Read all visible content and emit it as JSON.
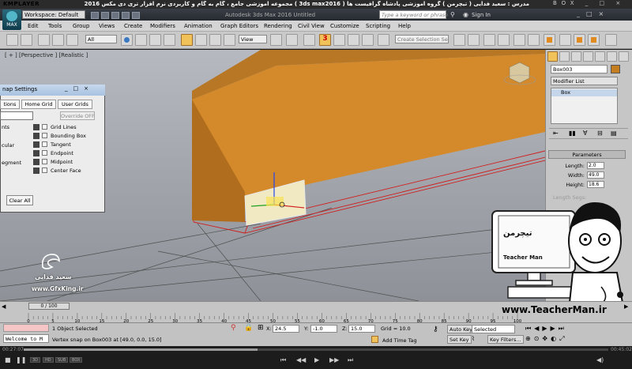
{
  "player": {
    "logo": "KMPLAYER",
    "caption": "مجموعه آموزشی جامع ، گام به گام و کاربردی نرم افزار تری دی مکس 2016 ( 3ds max2016 )  مدرس : سعید فدایی ( تیچرمن ) گروه آموزشی پادشاه گرافیست ها",
    "controls": "BOX _ □ ×",
    "elapsed": "00:27:07",
    "total": "00:45:02",
    "progress": 0.4,
    "qualities": [
      "3D",
      "HD",
      "SUB",
      "BOX"
    ]
  },
  "max": {
    "logo_text": "MAX",
    "workspace": "Workspace: Default",
    "title": "Autodesk 3ds Max 2016    Untitled",
    "search_placeholder": "Type a keyword or phrase",
    "signin": "Sign In",
    "menu": [
      "Edit",
      "Tools",
      "Group",
      "Views",
      "Create",
      "Modifiers",
      "Animation",
      "Graph Editors",
      "Rendering",
      "Civil View",
      "Customize",
      "Scripting",
      "Help"
    ],
    "toolbar": {
      "filter": "All",
      "ref_coord": "View",
      "snap_value": "3",
      "selection_set": "Create Selection Se"
    },
    "viewport_label": "[ + ] [Perspective ] [Realistic ]"
  },
  "snap_dialog": {
    "title": "nap Settings",
    "tabs": [
      "tions",
      "Home Grid",
      "User Grids"
    ],
    "override": "Override OFF",
    "row_labels": [
      "nts",
      "",
      "cular",
      "",
      "egment",
      ""
    ],
    "options": [
      "Grid Lines",
      "Bounding Box",
      "Tangent",
      "Endpoint",
      "Midpoint",
      "Center Face"
    ],
    "clear_all": "Clear All"
  },
  "command_panel": {
    "object_name": "Box003",
    "modifier_list": "Modifier List",
    "stack_item": "Box",
    "parameters_title": "Parameters",
    "params": [
      {
        "label": "Length:",
        "value": "2.0"
      },
      {
        "label": "Width:",
        "value": "49.0"
      },
      {
        "label": "Height:",
        "value": "18.6"
      }
    ],
    "faded_label": "Length Segs:"
  },
  "timeline": {
    "slider": "0 / 100",
    "ticks": [
      "0",
      "5",
      "10",
      "15",
      "20",
      "25",
      "30",
      "35",
      "40",
      "45",
      "50",
      "55",
      "60",
      "65",
      "70",
      "75",
      "80",
      "85",
      "90",
      "95",
      "100"
    ]
  },
  "status": {
    "welcome": "Welcome to M",
    "selection": "1 Object Selected",
    "snap_msg": "Vertex snap on Box003 at [49.0, 0.0, 15.0]",
    "x": "24.5",
    "y": "-1.0",
    "z": "15.0",
    "grid": "Grid = 10.0",
    "add_time_tag": "Add Time Tag",
    "auto_key": "Auto Key",
    "set_key": "Set Key",
    "selected": "Selected",
    "key_filters": "Key Filters..."
  },
  "watermarks": {
    "author": "سعید فدایی",
    "site": "www.GfxKing.ir",
    "teacher_url": "www.TeacherMan.ir",
    "teacher_name": "Teacher Man",
    "teacher_farsi": "تیچرمن"
  },
  "colors": {
    "box": "#c47e20",
    "grid_red": "#d11d1d",
    "accent_yellow": "#f2c25a"
  }
}
